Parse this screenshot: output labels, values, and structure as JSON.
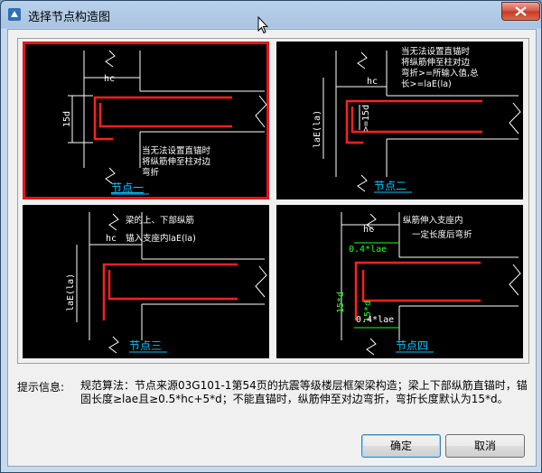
{
  "window": {
    "title": "选择节点构造图"
  },
  "panels": [
    {
      "caption": "节点一",
      "note": [
        "当无法设置直锚时",
        "将纵筋伸至柱对边",
        "弯折"
      ],
      "dims": [
        "hc",
        "15d"
      ]
    },
    {
      "caption": "节点二",
      "note": [
        "当无法设置直锚时",
        "将纵筋伸至柱对边",
        "弯折>=所输入值,总",
        "长>=laE(la)"
      ],
      "dims": [
        "hc",
        "laE(la)",
        ">=15d"
      ]
    },
    {
      "caption": "节点三",
      "note": [
        "梁的上、下部纵筋",
        "锚入支座内laE(la)"
      ],
      "dims": [
        "hc",
        "laE(la)"
      ]
    },
    {
      "caption": "节点四",
      "note": [
        "纵筋伸入支座内",
        "一定长度后弯折"
      ],
      "dims": [
        "hc",
        "0.4*lae",
        "15*d",
        "15*d",
        "0.4*lae"
      ]
    }
  ],
  "hint": {
    "label": "提示信息:",
    "text": "规范算法：节点来源03G101-1第54页的抗震等级楼层框架梁构造；梁上下部纵筋直锚时，锚固长度≥lae且≥0.5*hc+5*d；不能直锚时，纵筋伸至对边弯折，弯折长度默认为15*d。"
  },
  "buttons": {
    "ok": "确定",
    "cancel": "取消"
  },
  "colors": {
    "selected_border": "#e8141b",
    "caption": "#00c8ff",
    "rebar": "#ff2020",
    "green_dim": "#22ff22"
  }
}
